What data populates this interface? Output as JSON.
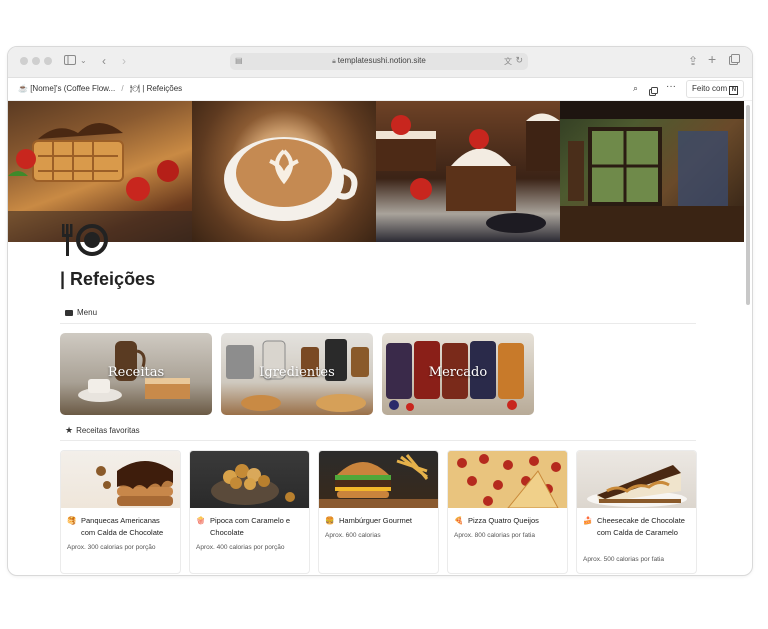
{
  "browser": {
    "url": "templatesushi.notion.site"
  },
  "breadcrumb": {
    "workspace": "[Nome]'s (Coffee Flow...",
    "separator": "/",
    "page": "| Refeições"
  },
  "toolbar": {
    "made_with": "Feito com"
  },
  "page": {
    "title": "| Refeições"
  },
  "menu_section": {
    "label": "Menu",
    "cards": [
      {
        "label": "Receitas"
      },
      {
        "label": "Igredientes"
      },
      {
        "label": "Mercado"
      }
    ]
  },
  "favorites_section": {
    "label": "Receitas favoritas",
    "recipes": [
      {
        "emoji": "🥞",
        "title": "Panquecas Americanas com Calda de Chocolate",
        "calories": "Aprox. 300 calorias por porção"
      },
      {
        "emoji": "🍿",
        "title": "Pipoca com Caramelo e Chocolate",
        "calories": "Aprox. 400 calorias por porção"
      },
      {
        "emoji": "🍔",
        "title": "Hambúrguer Gourmet",
        "calories": "Aprox. 600 calorias"
      },
      {
        "emoji": "🍕",
        "title": "Pizza Quatro Queijos",
        "calories": "Aprox. 800 calorias por fatia"
      },
      {
        "emoji": "🍰",
        "title": "Cheesecake de Chocolate com Calda de Caramelo",
        "calories": "Aprox. 500 calorias por fatia"
      }
    ]
  },
  "colors": {
    "titlebar": "#efefef",
    "accent_text": "#222222"
  }
}
